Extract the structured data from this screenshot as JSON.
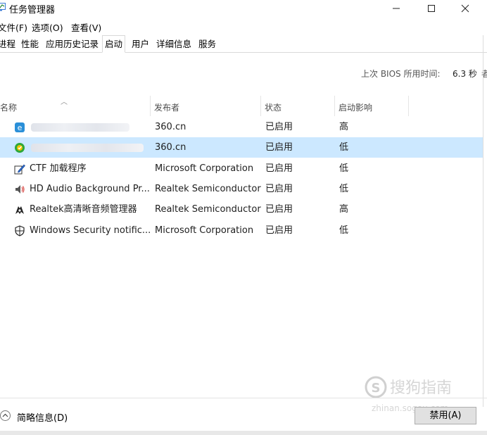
{
  "window": {
    "title": "任务管理器"
  },
  "menu": [
    "文件(F)",
    "选项(O)",
    "查看(V)"
  ],
  "tabs": [
    "进程",
    "性能",
    "应用历史记录",
    "启动",
    "用户",
    "详细信息",
    "服务"
  ],
  "active_tab": "启动",
  "bios": {
    "label": "上次 BIOS 所用时间:",
    "value": "6.3 秒",
    "trail": "者"
  },
  "columns": [
    "名称",
    "发布者",
    "状态",
    "启动影响"
  ],
  "rows": [
    {
      "name": "",
      "publisher": "360.cn",
      "status": "已启用",
      "impact": "高",
      "icon": "360-browser-icon",
      "name_redacted": true
    },
    {
      "name": "",
      "publisher": "360.cn",
      "status": "已启用",
      "impact": "低",
      "icon": "360-security-icon",
      "name_redacted": true,
      "selected": true
    },
    {
      "name": "CTF 加载程序",
      "publisher": "Microsoft Corporation",
      "status": "已启用",
      "impact": "低",
      "icon": "ctf-pen-icon"
    },
    {
      "name": "HD Audio Background Pr...",
      "publisher": "Realtek Semiconductor",
      "status": "已启用",
      "impact": "低",
      "icon": "speaker-icon"
    },
    {
      "name": "Realtek高清晰音频管理器",
      "publisher": "Realtek Semiconductor",
      "status": "已启用",
      "impact": "高",
      "icon": "realtek-audio-icon"
    },
    {
      "name": "Windows Security notific...",
      "publisher": "Microsoft Corporation",
      "status": "已启用",
      "impact": "低",
      "icon": "shield-icon"
    }
  ],
  "footer": {
    "less_details": "简略信息(D)",
    "disable": "禁用(A)"
  },
  "watermark": {
    "line1": "搜狗指南",
    "line2": "zhinan.sogou.com"
  },
  "colors": {
    "selected_row": "#cce8ff",
    "button_bg": "#e1e1e1"
  }
}
